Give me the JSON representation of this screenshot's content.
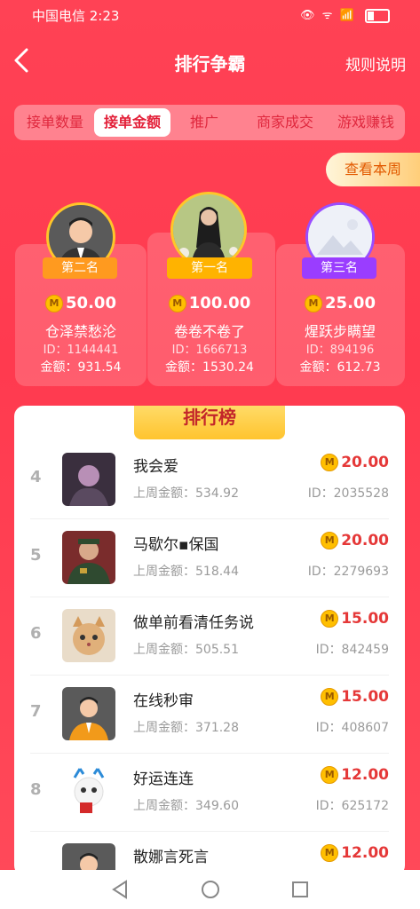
{
  "status": {
    "carrier": "中国电信 2:23",
    "icons": "👁 ᯤ 📶"
  },
  "header": {
    "title": "排行争霸",
    "rules": "规则说明"
  },
  "tabs": [
    {
      "label": "接单数量",
      "active": false
    },
    {
      "label": "接单金额",
      "active": true
    },
    {
      "label": "推广",
      "active": false
    },
    {
      "label": "商家成交",
      "active": false
    },
    {
      "label": "游戏赚钱",
      "active": false
    }
  ],
  "week_button": "查看本周",
  "podium": {
    "second": {
      "rank": "第二名",
      "amount": "50.00",
      "name": "仓泽禁愁沦",
      "id": "ID：1144441",
      "total": "金额：931.54"
    },
    "first": {
      "rank": "第一名",
      "amount": "100.00",
      "name": "卷卷不卷了",
      "id": "ID：1666713",
      "total": "金额：1530.24"
    },
    "third": {
      "rank": "第三名",
      "amount": "25.00",
      "name": "煋跃步瞒望",
      "id": "ID：894196",
      "total": "金额：612.73"
    }
  },
  "list_title": "排行榜",
  "rows": [
    {
      "idx": "4",
      "name": "我会爱",
      "last": "上周金额：534.92",
      "amount": "20.00",
      "id": "ID：2035528"
    },
    {
      "idx": "5",
      "name": "马歇尔▪保国",
      "last": "上周金额：518.44",
      "amount": "20.00",
      "id": "ID：2279693"
    },
    {
      "idx": "6",
      "name": "做单前看清任务说",
      "last": "上周金额：505.51",
      "amount": "15.00",
      "id": "ID：842459"
    },
    {
      "idx": "7",
      "name": "在线秒审",
      "last": "上周金额：371.28",
      "amount": "15.00",
      "id": "ID：408607"
    },
    {
      "idx": "8",
      "name": "好运连连",
      "last": "上周金额：349.60",
      "amount": "12.00",
      "id": "ID：625172"
    },
    {
      "idx": "",
      "name": "散娜言死言",
      "last": "",
      "amount": "12.00",
      "id": ""
    }
  ],
  "colors": {
    "accent": "#ff3b4e",
    "gold": "#ffc629",
    "purple": "#9a4dff"
  }
}
